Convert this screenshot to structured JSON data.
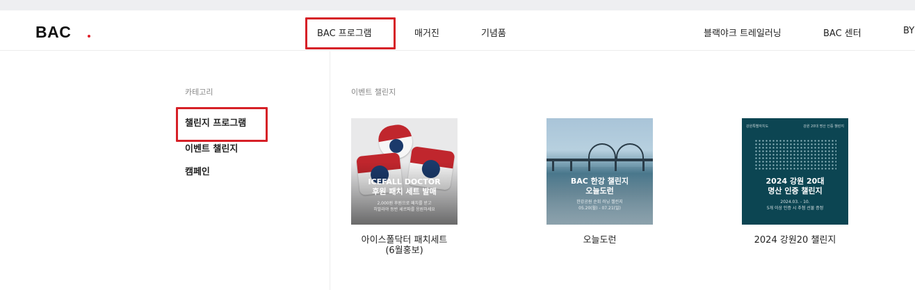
{
  "header": {
    "logo": "BAC",
    "nav": [
      "BAC 프로그램",
      "매거진",
      "기념품"
    ],
    "right_nav": [
      "블랙야크 트레일러닝",
      "BAC 센터",
      "BY"
    ]
  },
  "categories": {
    "label": "카테고리",
    "items": [
      "챌린지 프로그램",
      "이벤트 챌린지",
      "캠페인"
    ]
  },
  "section": {
    "label": "이벤트 챌린지",
    "cards": [
      {
        "overlay_title_1": "ICEFALL DOCTOR",
        "overlay_title_2": "후원 패치 세트 발매",
        "overlay_sub_1": "2,000원 후원으로 패치를 받고",
        "overlay_sub_2": "히말라야 등반 셰르파를 응원하세요",
        "caption_1": "아이스폴닥터 패치세트",
        "caption_2": "(6월홍보)"
      },
      {
        "overlay_title_1": "BAC 한강 챌린지",
        "overlay_title_2": "오늘도런",
        "overlay_sub_1": "한강공원 순회 러닝 챌린지",
        "overlay_sub_2": "05.20(월) - 07.21(일)",
        "caption_1": "오늘도런"
      },
      {
        "overlay_title_1": "2024 강원 20대",
        "overlay_title_2": "명산 인증 챌린지",
        "overlay_sub_1": "2024.03. - 10.",
        "overlay_sub_2": "5개 이상 인증 시 추첨 선물 증정",
        "top_left": "강원특별자치도",
        "top_right": "강원 20대 명산 인증 챌린지",
        "caption_1": "2024 강원20 챌린지"
      }
    ]
  },
  "colors": {
    "accent": "#d62027",
    "logo_dot": "#e0202a"
  }
}
